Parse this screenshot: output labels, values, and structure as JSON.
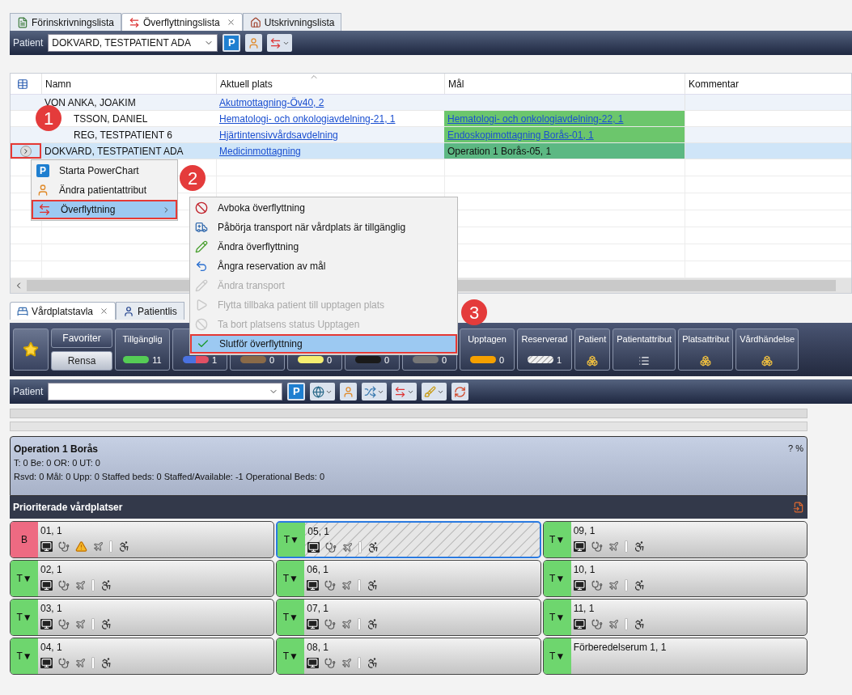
{
  "top_tabs": [
    {
      "label": "Förinskrivningslista",
      "kind": "preadmission",
      "selected": false
    },
    {
      "label": "Överflyttningslista",
      "kind": "transfer",
      "selected": true
    },
    {
      "label": "Utskrivningslista",
      "kind": "discharge",
      "selected": false
    }
  ],
  "patient_toolbar": {
    "label": "Patient",
    "value": "DOKVARD, TESTPATIENT ADA",
    "p_button": "P"
  },
  "table": {
    "columns": [
      "Namn",
      "Aktuell plats",
      "Mål",
      "Kommentar"
    ],
    "rows": [
      {
        "name": "VON ANKA, JOAKIM",
        "location": "Akutmottagning-Öv40, 2",
        "selected": false,
        "marker_over_name": false,
        "annotated": false
      },
      {
        "name": "TSSON, DANIEL",
        "location": "Hematologi- och onkologiavdelning-21, 1",
        "goal": {
          "text": "Hematologi- och onkologiavdelning-22, 1",
          "color": "#6cc66c",
          "link": true
        },
        "selected": false,
        "marker_over_name": true,
        "annotated": false
      },
      {
        "name": "REG, TESTPATIENT 6",
        "location": "Hjärtintensivvårdsavdelning",
        "goal": {
          "text": "Endoskopimottagning Borås-01, 1",
          "color": "#6cc66c",
          "link": true
        },
        "selected": false,
        "marker_over_name": true,
        "annotated": false
      },
      {
        "name": "DOKVARD, TESTPATIENT ADA",
        "location": "Medicinmottagning",
        "goal": {
          "text": "Operation 1 Borås-05, 1",
          "color": "#5cb883",
          "link": false
        },
        "selected": true,
        "marker_over_name": false,
        "annotated": true
      }
    ]
  },
  "context_menu": {
    "items": [
      {
        "label": "Starta PowerChart",
        "kind": "powerchart",
        "icon_text": "P",
        "selected": false,
        "annotated": false,
        "submenu": false
      },
      {
        "label": "Ändra patientattribut",
        "kind": "attributes",
        "selected": false,
        "annotated": false,
        "submenu": false
      },
      {
        "label": "Överflyttning",
        "kind": "transfer",
        "selected": true,
        "annotated": true,
        "submenu": true
      }
    ]
  },
  "submenu": {
    "items": [
      {
        "label": "Avboka överflyttning",
        "kind": "cancel",
        "disabled": false,
        "selected": false,
        "annotated": false
      },
      {
        "label": "Påbörja transport när vårdplats är tillgänglig",
        "kind": "ambulance",
        "disabled": false,
        "selected": false,
        "annotated": false
      },
      {
        "label": "Ändra överflyttning",
        "kind": "edit",
        "disabled": false,
        "selected": false,
        "annotated": false
      },
      {
        "label": "Ångra reservation av mål",
        "kind": "undo",
        "disabled": false,
        "selected": false,
        "annotated": false
      },
      {
        "label": "Ändra transport",
        "kind": "edit",
        "disabled": true,
        "selected": false,
        "annotated": false
      },
      {
        "label": "Flytta tillbaka patient till upptagen plats",
        "kind": "play",
        "disabled": true,
        "selected": false,
        "annotated": false
      },
      {
        "label": "Ta bort platsens status Upptagen",
        "kind": "cancel",
        "disabled": true,
        "selected": false,
        "annotated": false
      },
      {
        "label": "Slutför överflyttning",
        "kind": "check",
        "disabled": false,
        "selected": true,
        "annotated": true
      }
    ]
  },
  "markers": [
    {
      "label": "1"
    },
    {
      "label": "2"
    },
    {
      "label": "3"
    }
  ],
  "bottom_tabs": [
    {
      "label": "Vårdplatstavla",
      "kind": "board",
      "selected": true
    },
    {
      "label": "Patientlis",
      "kind": "patients",
      "selected": false
    }
  ],
  "filter_bar": {
    "favorites": "Favoriter",
    "clear": "Rensa",
    "filters": [
      {
        "kind": "solid",
        "label": "Tillgänglig",
        "count": "11",
        "color": "#55cc55"
      },
      {
        "kind": "split",
        "count": "1",
        "color": "#4a72e0"
      },
      {
        "kind": "solid",
        "count": "0",
        "color": "#8a6a48"
      },
      {
        "kind": "solid",
        "count": "0",
        "color": "#f5ee70"
      },
      {
        "kind": "solid",
        "count": "0",
        "color": "#1a1a1a"
      },
      {
        "kind": "solid",
        "count": "0",
        "color": "#777777"
      },
      {
        "kind": "solid",
        "label": "Upptagen",
        "count": "0",
        "color": "#f5a000"
      },
      {
        "kind": "hatched",
        "label": "Reserverad",
        "count": "1"
      },
      {
        "kind": "blocks",
        "label": "Patient"
      },
      {
        "kind": "list",
        "label": "Patientattribut"
      },
      {
        "kind": "blocks",
        "label": "Platsattribut"
      },
      {
        "kind": "blocks",
        "label": "Vårdhändelse"
      }
    ]
  },
  "board_toolbar": {
    "label": "Patient",
    "p_button": "P"
  },
  "summary": {
    "title": "Operation 1 Borås",
    "line_1": "T: 0 Be: 0 OR: 0 UT: 0",
    "line_2": "Rsvd: 0 Mål: 0 Upp: 0 Staffed beds: 0 Staffed/Available: -1 Operational Beds: 0",
    "percent": "? %"
  },
  "section_header": "Prioriterade vårdplatser",
  "beds": [
    {
      "name": "01, 1",
      "status": "B",
      "color": "#ee6a82",
      "selected": false,
      "hatched": false,
      "equipment": true,
      "warning": true
    },
    {
      "name": "05, 1",
      "status": "T▼",
      "color": "#6ed66e",
      "selected": true,
      "hatched": true,
      "equipment": true,
      "warning": false
    },
    {
      "name": "09, 1",
      "status": "T▼",
      "color": "#6ed66e",
      "selected": false,
      "hatched": false,
      "equipment": true,
      "warning": false
    },
    {
      "name": "02, 1",
      "status": "T▼",
      "color": "#6ed66e",
      "selected": false,
      "hatched": false,
      "equipment": true,
      "warning": false
    },
    {
      "name": "06, 1",
      "status": "T▼",
      "color": "#6ed66e",
      "selected": false,
      "hatched": false,
      "equipment": true,
      "warning": false
    },
    {
      "name": "10, 1",
      "status": "T▼",
      "color": "#6ed66e",
      "selected": false,
      "hatched": false,
      "equipment": true,
      "warning": false
    },
    {
      "name": "03, 1",
      "status": "T▼",
      "color": "#6ed66e",
      "selected": false,
      "hatched": false,
      "equipment": true,
      "warning": false
    },
    {
      "name": "07, 1",
      "status": "T▼",
      "color": "#6ed66e",
      "selected": false,
      "hatched": false,
      "equipment": true,
      "warning": false
    },
    {
      "name": "11, 1",
      "status": "T▼",
      "color": "#6ed66e",
      "selected": false,
      "hatched": false,
      "equipment": true,
      "warning": false
    },
    {
      "name": "04, 1",
      "status": "T▼",
      "color": "#6ed66e",
      "selected": false,
      "hatched": false,
      "equipment": true,
      "warning": false
    },
    {
      "name": "08, 1",
      "status": "T▼",
      "color": "#6ed66e",
      "selected": false,
      "hatched": false,
      "equipment": true,
      "warning": false
    },
    {
      "name": "Förberedelserum 1, 1",
      "status": "T▼",
      "color": "#6ed66e",
      "selected": false,
      "hatched": false,
      "equipment": false,
      "warning": false
    }
  ]
}
